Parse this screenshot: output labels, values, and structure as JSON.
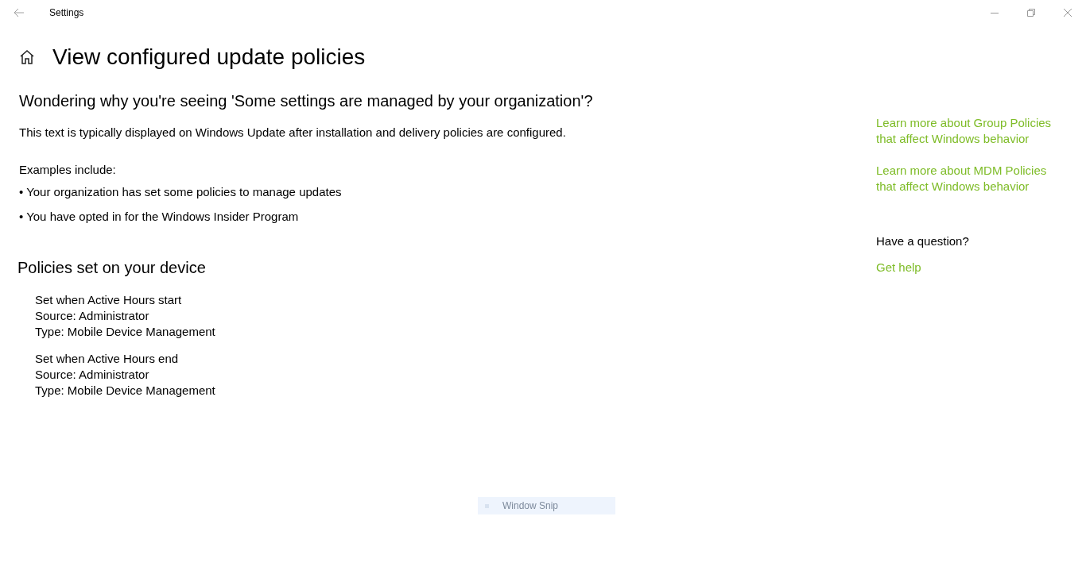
{
  "window": {
    "title": "Settings"
  },
  "page_title": "View configured update policies",
  "intro": {
    "heading": "Wondering why you're seeing 'Some settings are managed by your organization'?",
    "description": "This text is typically displayed on Windows Update after installation and delivery policies are configured.",
    "examples_label": "Examples include:",
    "examples": [
      "• Your organization has set some policies to manage updates",
      "• You have opted in for the Windows Insider Program"
    ]
  },
  "policies": {
    "heading": "Policies set on your device",
    "items": [
      {
        "name": "Set when Active Hours start",
        "source": "Source: Administrator",
        "type": "Type: Mobile Device Management"
      },
      {
        "name": "Set when Active Hours end",
        "source": "Source: Administrator",
        "type": "Type: Mobile Device Management"
      }
    ]
  },
  "sidebar": {
    "links": [
      {
        "lines": [
          "Learn more about Group Policies",
          "that affect Windows behavior"
        ]
      },
      {
        "lines": [
          "Learn more about MDM Policies",
          "that affect Windows behavior"
        ]
      }
    ],
    "question": "Have a question?",
    "help_link": "Get help"
  },
  "snip_tooltip": "Window Snip"
}
